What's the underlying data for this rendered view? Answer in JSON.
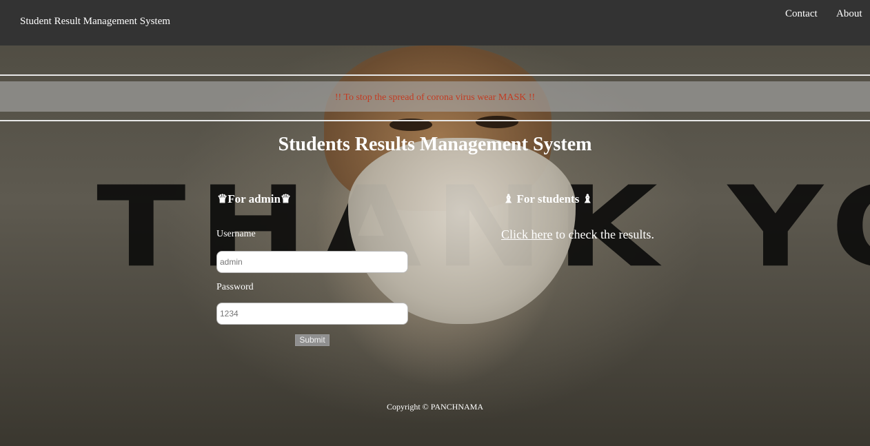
{
  "navbar": {
    "brand": "Student Result Management System",
    "links": {
      "contact": "Contact",
      "about": "About"
    }
  },
  "banner": {
    "text": "!! To stop the spread of corona virus wear MASK !!",
    "text_color": "#c23b22"
  },
  "background": {
    "image_text": "THANK YOU"
  },
  "main": {
    "title": "Students Results Management System"
  },
  "admin": {
    "heading": "♛For admin♛",
    "username_label": "Username",
    "username_placeholder": "admin",
    "password_label": "Password",
    "password_placeholder": "1234",
    "submit_label": "Submit"
  },
  "students": {
    "heading": "♝ For students ♝",
    "link_text": "Click here",
    "after_link_text": " to check the results."
  },
  "footer": {
    "copyright": "Copyright © PANCHNAMA"
  },
  "colors": {
    "navbar_bg": "#333333",
    "text": "#ffffff"
  }
}
